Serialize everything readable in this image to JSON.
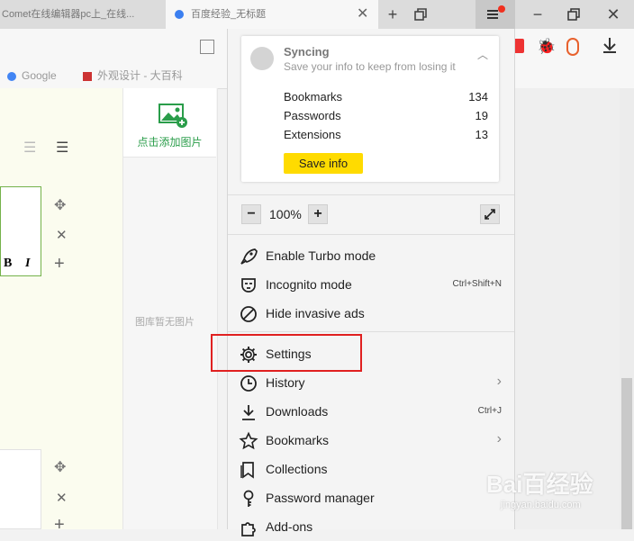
{
  "tabs": {
    "tab1_title": "Comet在线编辑器pc上_在线...",
    "tab2_title": "百度经验_无标题",
    "active_index": 2
  },
  "bookmarks_bar": {
    "items": [
      "Google",
      "外观设计 - 大百科",
      "..."
    ]
  },
  "editor": {
    "bold_label": "B",
    "italic_label": "I",
    "add_image_label": "点击添加图片",
    "no_image_label": "图库暂无图片"
  },
  "menu": {
    "sync_title": "Syncing",
    "sync_subtitle": "Save your info to keep from losing it",
    "stats": [
      {
        "label": "Bookmarks",
        "value": "134"
      },
      {
        "label": "Passwords",
        "value": "19"
      },
      {
        "label": "Extensions",
        "value": "13"
      }
    ],
    "save_button": "Save info",
    "zoom_level": "100%",
    "zoom_out": "−",
    "zoom_in": "+",
    "items": [
      {
        "label": "Enable Turbo mode",
        "shortcut": "",
        "icon": "rocket-icon"
      },
      {
        "label": "Incognito mode",
        "shortcut": "Ctrl+Shift+N",
        "icon": "mask-icon"
      },
      {
        "label": "Hide invasive ads",
        "shortcut": "",
        "icon": "block-icon"
      },
      {
        "label": "Settings",
        "shortcut": "",
        "icon": "gear-icon"
      },
      {
        "label": "History",
        "shortcut": "",
        "icon": "clock-icon",
        "submenu": true
      },
      {
        "label": "Downloads",
        "shortcut": "Ctrl+J",
        "icon": "download-icon"
      },
      {
        "label": "Bookmarks",
        "shortcut": "",
        "icon": "star-icon",
        "submenu": true
      },
      {
        "label": "Collections",
        "shortcut": "",
        "icon": "collections-icon"
      },
      {
        "label": "Password manager",
        "shortcut": "",
        "icon": "key-icon"
      },
      {
        "label": "Add-ons",
        "shortcut": "",
        "icon": "puzzle-icon"
      }
    ]
  },
  "watermark": {
    "brand": "Bai百经验",
    "url": "jingyan.baidu.com"
  },
  "colors": {
    "accent_yellow": "#ffdb00",
    "highlight_red": "#e02020",
    "image_icon_green": "#2a9d4a"
  }
}
